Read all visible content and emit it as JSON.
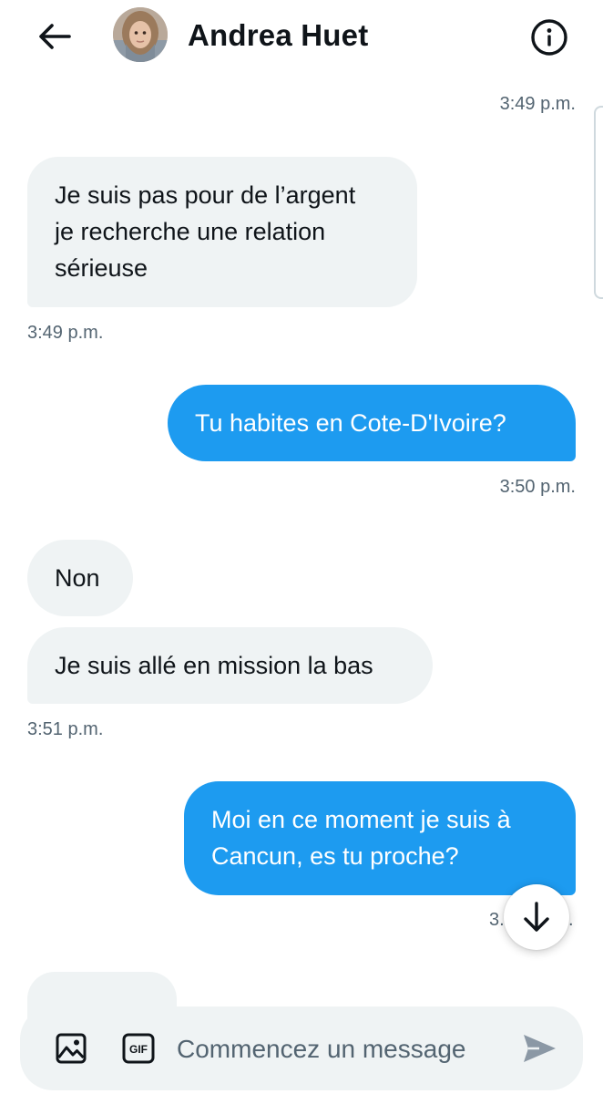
{
  "header": {
    "contact_name": "Andrea Huet",
    "back_icon": "arrow-left-icon",
    "info_icon": "info-icon"
  },
  "messages": [
    {
      "direction": "outgoing",
      "text": "",
      "time": "3:49 p.m."
    },
    {
      "direction": "incoming",
      "lines": [
        "Je suis pas pour de l’argent",
        "je recherche une relation",
        "sérieuse"
      ],
      "time": "3:49 p.m."
    },
    {
      "direction": "outgoing",
      "lines": [
        "Tu habites en Cote-D'Ivoire?"
      ],
      "time": "3:50 p.m."
    },
    {
      "direction": "incoming",
      "lines": [
        "Non"
      ]
    },
    {
      "direction": "incoming",
      "lines": [
        "Je suis allé en mission la bas"
      ],
      "time": "3:51 p.m."
    },
    {
      "direction": "outgoing",
      "lines": [
        "Moi en ce moment je suis à",
        "Cancun, es tu proche?"
      ],
      "time_partial_left": "3.",
      "time_partial_right": "."
    }
  ],
  "composer": {
    "placeholder": "Commencez un message",
    "gif_label": "GIF",
    "media_icon": "image-icon",
    "send_icon": "send-icon"
  },
  "colors": {
    "accent": "#1d9bf0",
    "incoming_bubble": "#eff3f4",
    "secondary_text": "#536471"
  }
}
